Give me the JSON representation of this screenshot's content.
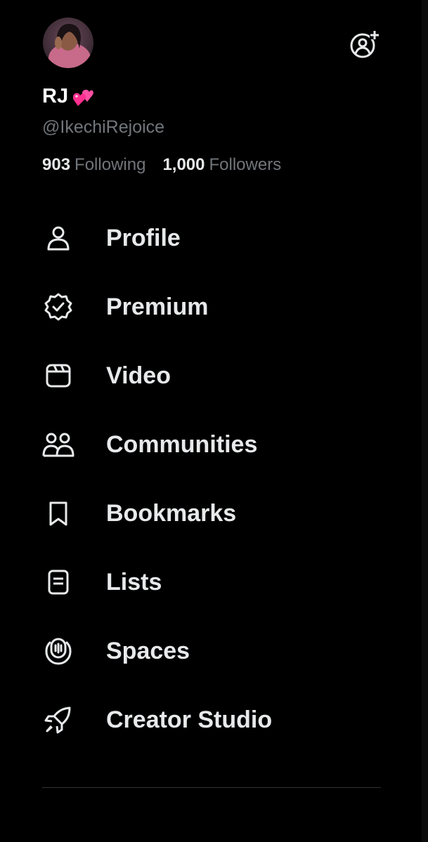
{
  "account": {
    "display_name": "RJ",
    "display_name_emoji": "💕",
    "handle": "@IkechiRejoice",
    "following_count": "903",
    "following_label": "Following",
    "followers_count": "1,000",
    "followers_label": "Followers"
  },
  "menu": [
    {
      "label": "Profile",
      "icon": "person-icon"
    },
    {
      "label": "Premium",
      "icon": "verified-badge-icon"
    },
    {
      "label": "Video",
      "icon": "video-icon"
    },
    {
      "label": "Communities",
      "icon": "communities-icon"
    },
    {
      "label": "Bookmarks",
      "icon": "bookmark-icon"
    },
    {
      "label": "Lists",
      "icon": "list-icon"
    },
    {
      "label": "Spaces",
      "icon": "spaces-icon"
    },
    {
      "label": "Creator Studio",
      "icon": "rocket-icon"
    }
  ],
  "colors": {
    "background": "#000000",
    "primary_text": "#e7e9ea",
    "secondary_text": "#71767b",
    "divider": "#2f3336"
  }
}
